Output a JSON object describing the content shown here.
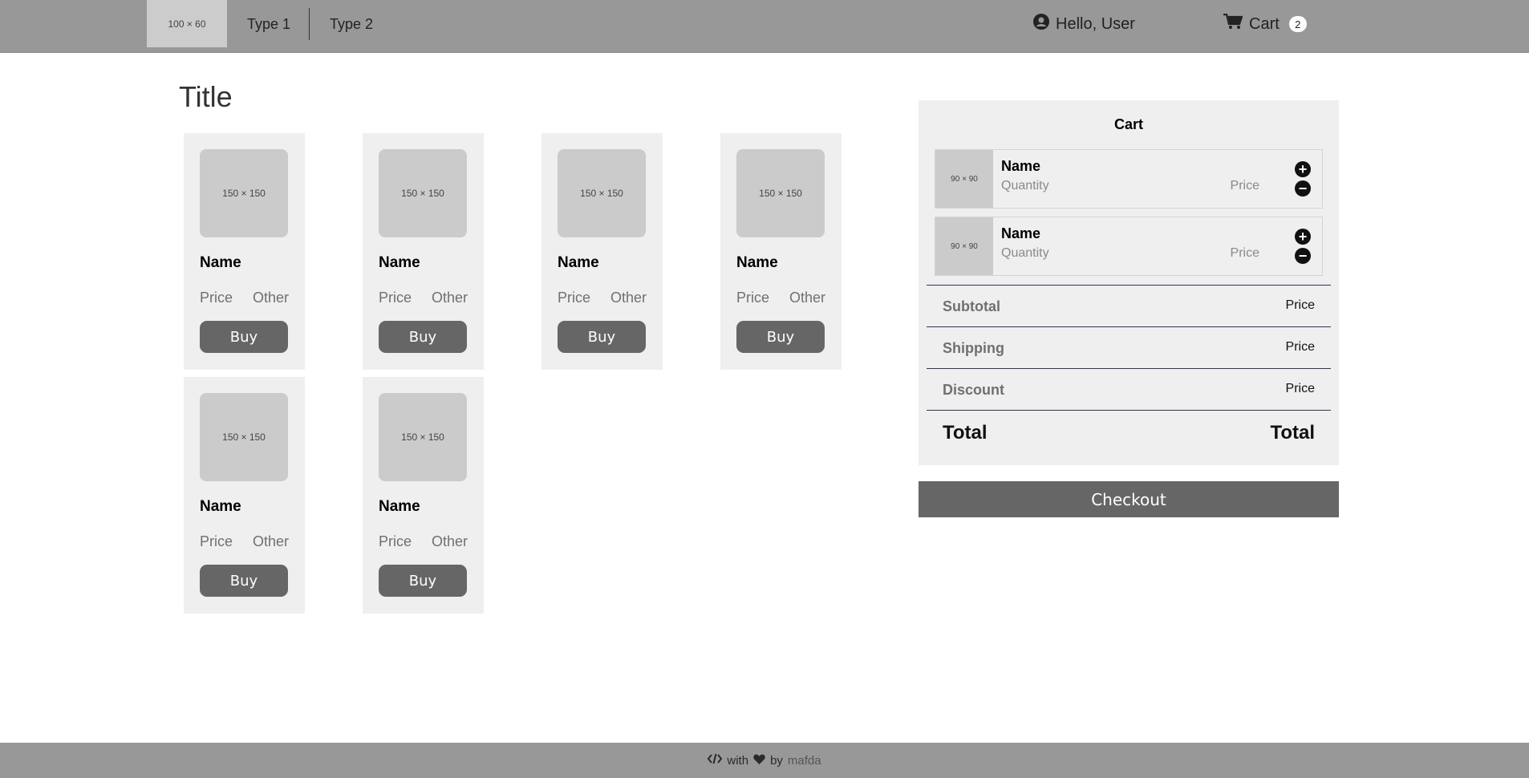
{
  "navbar": {
    "logo_text": "100 × 60",
    "links": [
      {
        "label": "Type 1"
      },
      {
        "label": "Type 2"
      }
    ],
    "user_greeting": "Hello, User",
    "cart_label": "Cart",
    "cart_count": "2"
  },
  "page_title": "Title",
  "products": [
    {
      "image_label": "150 × 150",
      "name": "Name",
      "price": "Price",
      "other": "Other",
      "buy_label": "Buy"
    },
    {
      "image_label": "150 × 150",
      "name": "Name",
      "price": "Price",
      "other": "Other",
      "buy_label": "Buy"
    },
    {
      "image_label": "150 × 150",
      "name": "Name",
      "price": "Price",
      "other": "Other",
      "buy_label": "Buy"
    },
    {
      "image_label": "150 × 150",
      "name": "Name",
      "price": "Price",
      "other": "Other",
      "buy_label": "Buy"
    },
    {
      "image_label": "150 × 150",
      "name": "Name",
      "price": "Price",
      "other": "Other",
      "buy_label": "Buy"
    },
    {
      "image_label": "150 × 150",
      "name": "Name",
      "price": "Price",
      "other": "Other",
      "buy_label": "Buy"
    }
  ],
  "cart": {
    "title": "Cart",
    "items": [
      {
        "image_label": "90 × 90",
        "name": "Name",
        "quantity": "Quantity",
        "price": "Price"
      },
      {
        "image_label": "90 × 90",
        "name": "Name",
        "quantity": "Quantity",
        "price": "Price"
      }
    ],
    "subtotal": {
      "label": "Subtotal",
      "value": "Price"
    },
    "shipping": {
      "label": "Shipping",
      "value": "Price"
    },
    "discount": {
      "label": "Discount",
      "value": "Price"
    },
    "total": {
      "label": "Total",
      "value": "Total"
    },
    "checkout_label": "Checkout"
  },
  "footer": {
    "with_text": "with",
    "by_text": "by",
    "author": "mafda"
  },
  "icons": {
    "user": "user-circle-icon",
    "cart": "shopping-cart-icon",
    "plus": "plus-circle-icon",
    "minus": "minus-circle-icon",
    "code": "code-icon",
    "heart": "heart-icon"
  },
  "colors": {
    "navbar_bg": "#989898",
    "button_bg": "#666666",
    "card_bg": "#efefef",
    "placeholder_bg": "#cbcbcb"
  }
}
